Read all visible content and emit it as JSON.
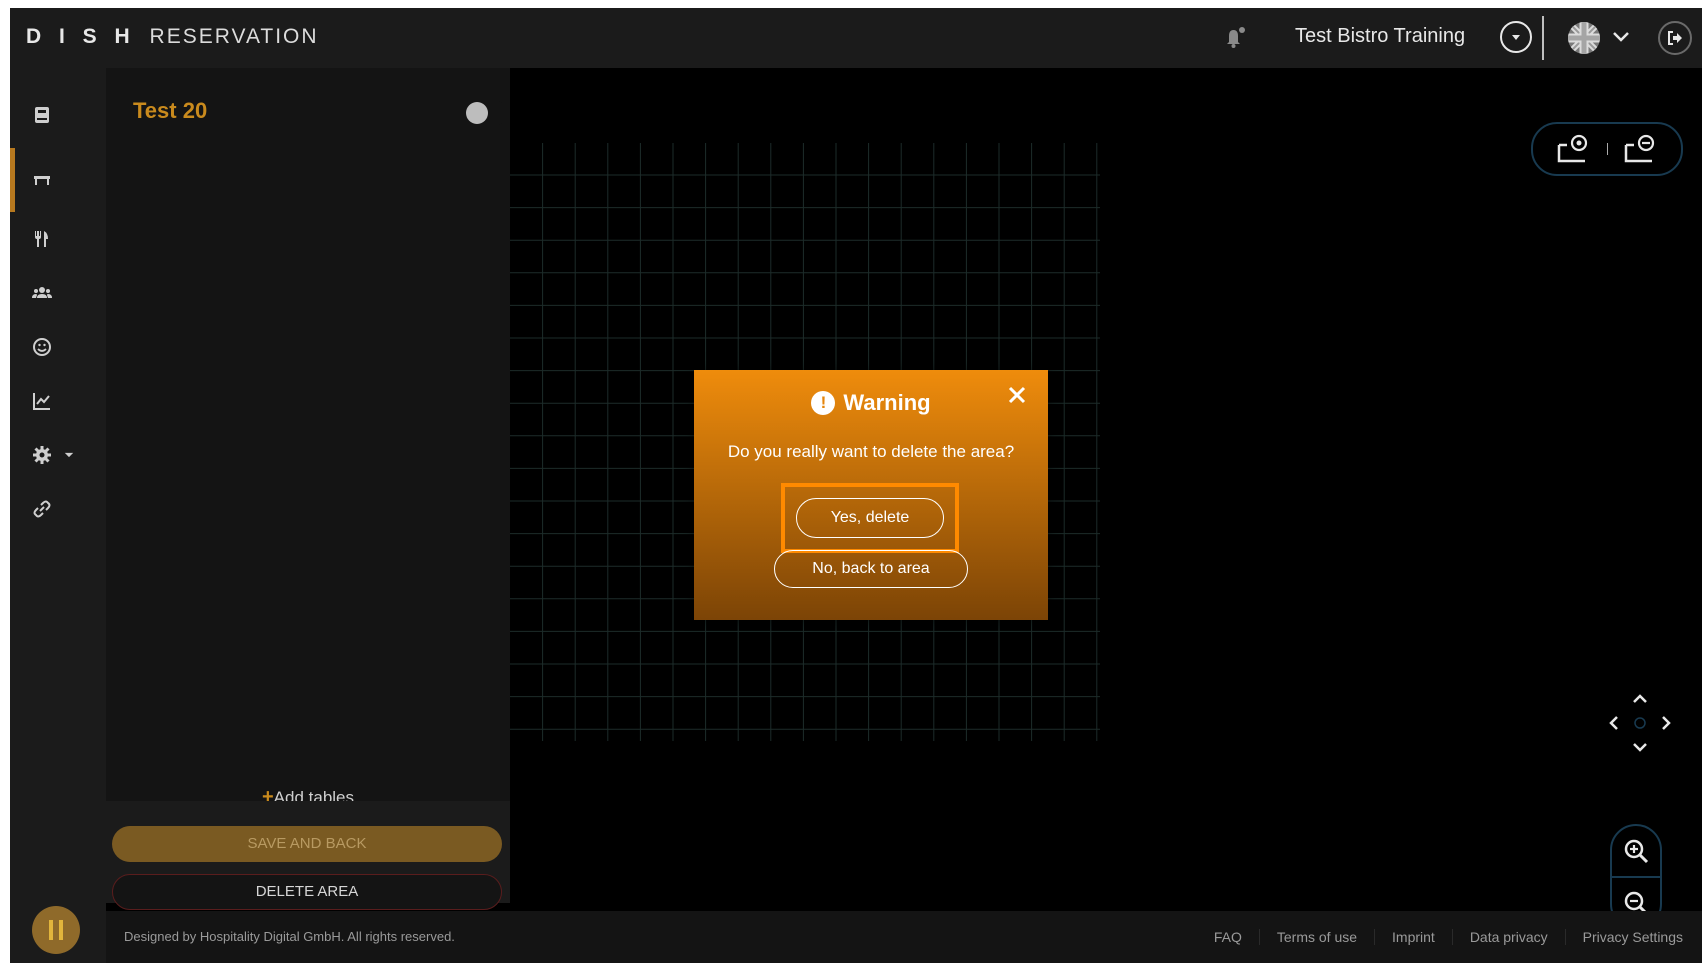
{
  "header": {
    "logo_bold": "D I S H",
    "logo_light": "RESERVATION",
    "restaurant_name": "Test Bistro Training",
    "icons": [
      "bell-icon",
      "chevron-down-circle-icon",
      "uk-flag-icon",
      "chevron-down-icon",
      "logout-icon"
    ]
  },
  "sidebar": {
    "items": [
      {
        "name": "reservations",
        "icon": "book-icon"
      },
      {
        "name": "tables",
        "icon": "table-icon",
        "active": true
      },
      {
        "name": "menu",
        "icon": "cutlery-icon"
      },
      {
        "name": "guests",
        "icon": "users-icon"
      },
      {
        "name": "feedback",
        "icon": "smiley-icon"
      },
      {
        "name": "reports",
        "icon": "chart-icon"
      },
      {
        "name": "settings",
        "icon": "gear-icon"
      },
      {
        "name": "integrations",
        "icon": "link-icon"
      }
    ]
  },
  "panel": {
    "area_name": "Test 20",
    "add_tables_plus": "+",
    "add_tables_label": "Add tables",
    "save_label": "SAVE AND BACK",
    "delete_area_label": "DELETE AREA"
  },
  "modal": {
    "title": "Warning",
    "warn_glyph": "!",
    "message": "Do you really want to delete the area?",
    "yes_label": "Yes, delete",
    "no_label": "No, back to area"
  },
  "footer": {
    "copyright": "Designed by Hospitality Digital GmbH. All rights reserved.",
    "links": [
      "FAQ",
      "Terms of use",
      "Imprint",
      "Data privacy",
      "Privacy Settings"
    ]
  },
  "colors": {
    "accent": "#c98a1d",
    "modal_top": "#ef8c0c",
    "modal_bottom": "#7c4406",
    "highlight": "#ff8a00",
    "background": "#000000",
    "panel": "#141414"
  }
}
